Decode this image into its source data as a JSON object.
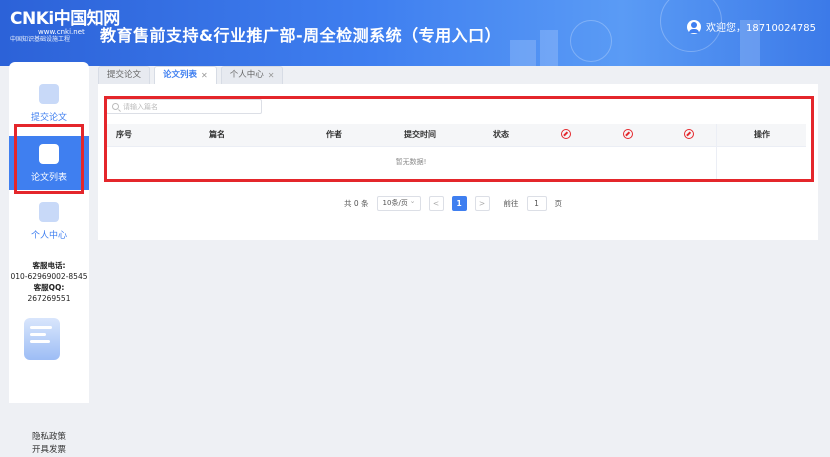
{
  "header": {
    "logo_text": "CNKi中国知网",
    "logo_url": "www.cnki.net",
    "logo_sub": "中国知识基础设施工程",
    "title": "教育售前支持&行业推广部-周全检测系统（专用入口）",
    "user_greeting": "欢迎您，18710024785"
  },
  "sidebar": {
    "items": [
      {
        "label": "提交论文",
        "icon": "upload-icon"
      },
      {
        "label": "论文列表",
        "icon": "edit-icon"
      },
      {
        "label": "个人中心",
        "icon": "user-icon"
      }
    ],
    "phone_label": "客服电话:",
    "phone": "010-62969002-8545",
    "qq_label": "客服QQ:",
    "qq": "267269551",
    "privacy": "隐私政策",
    "invoice": "开具发票"
  },
  "tabs": [
    {
      "label": "提交论文",
      "closable": false
    },
    {
      "label": "论文列表",
      "closable": true
    },
    {
      "label": "个人中心",
      "closable": true
    }
  ],
  "search": {
    "placeholder": "请输入篇名"
  },
  "table": {
    "columns": [
      "序号",
      "篇名",
      "作者",
      "提交时间",
      "状态"
    ],
    "icon_columns": [
      "report-icon-1",
      "report-icon-2",
      "report-icon-3"
    ],
    "action_column": "操作",
    "empty_text": "暂无数据!"
  },
  "pagination": {
    "total": "共 0 条",
    "page_size": "10条/页",
    "current_page": "1",
    "goto_label": "前往",
    "goto_value": "1",
    "page_unit": "页",
    "prev": "<",
    "next": ">"
  },
  "colors": {
    "accent": "#3f7ff0",
    "highlight": "#e4262b"
  }
}
